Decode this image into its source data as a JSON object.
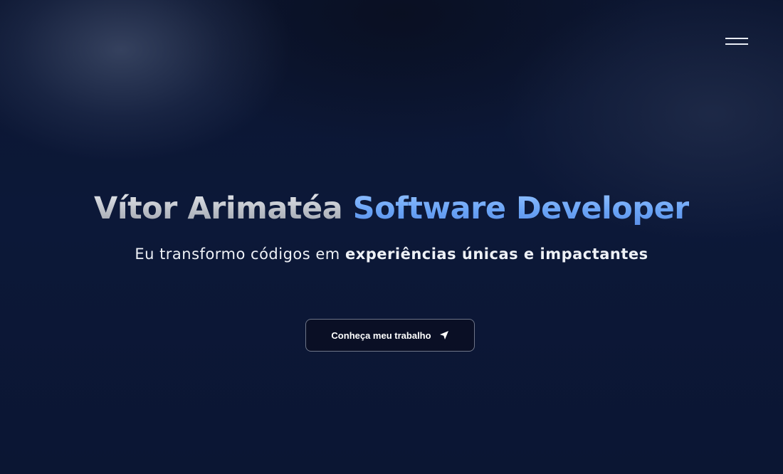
{
  "header": {
    "menu_icon": "hamburger-menu-icon"
  },
  "hero": {
    "title_name": "Vítor Arimatéa",
    "title_role": "Software Developer",
    "subtitle_plain": "Eu transformo códigos em",
    "subtitle_emphasis": "experiências únicas e impactantes"
  },
  "cta": {
    "label": "Conheça meu trabalho",
    "icon": "send-arrow-icon"
  },
  "colors": {
    "background": "#0b1530",
    "accent_blue": "#6aa4f6",
    "name_silver": "#c4c8cf",
    "button_border": "#6e7588"
  }
}
